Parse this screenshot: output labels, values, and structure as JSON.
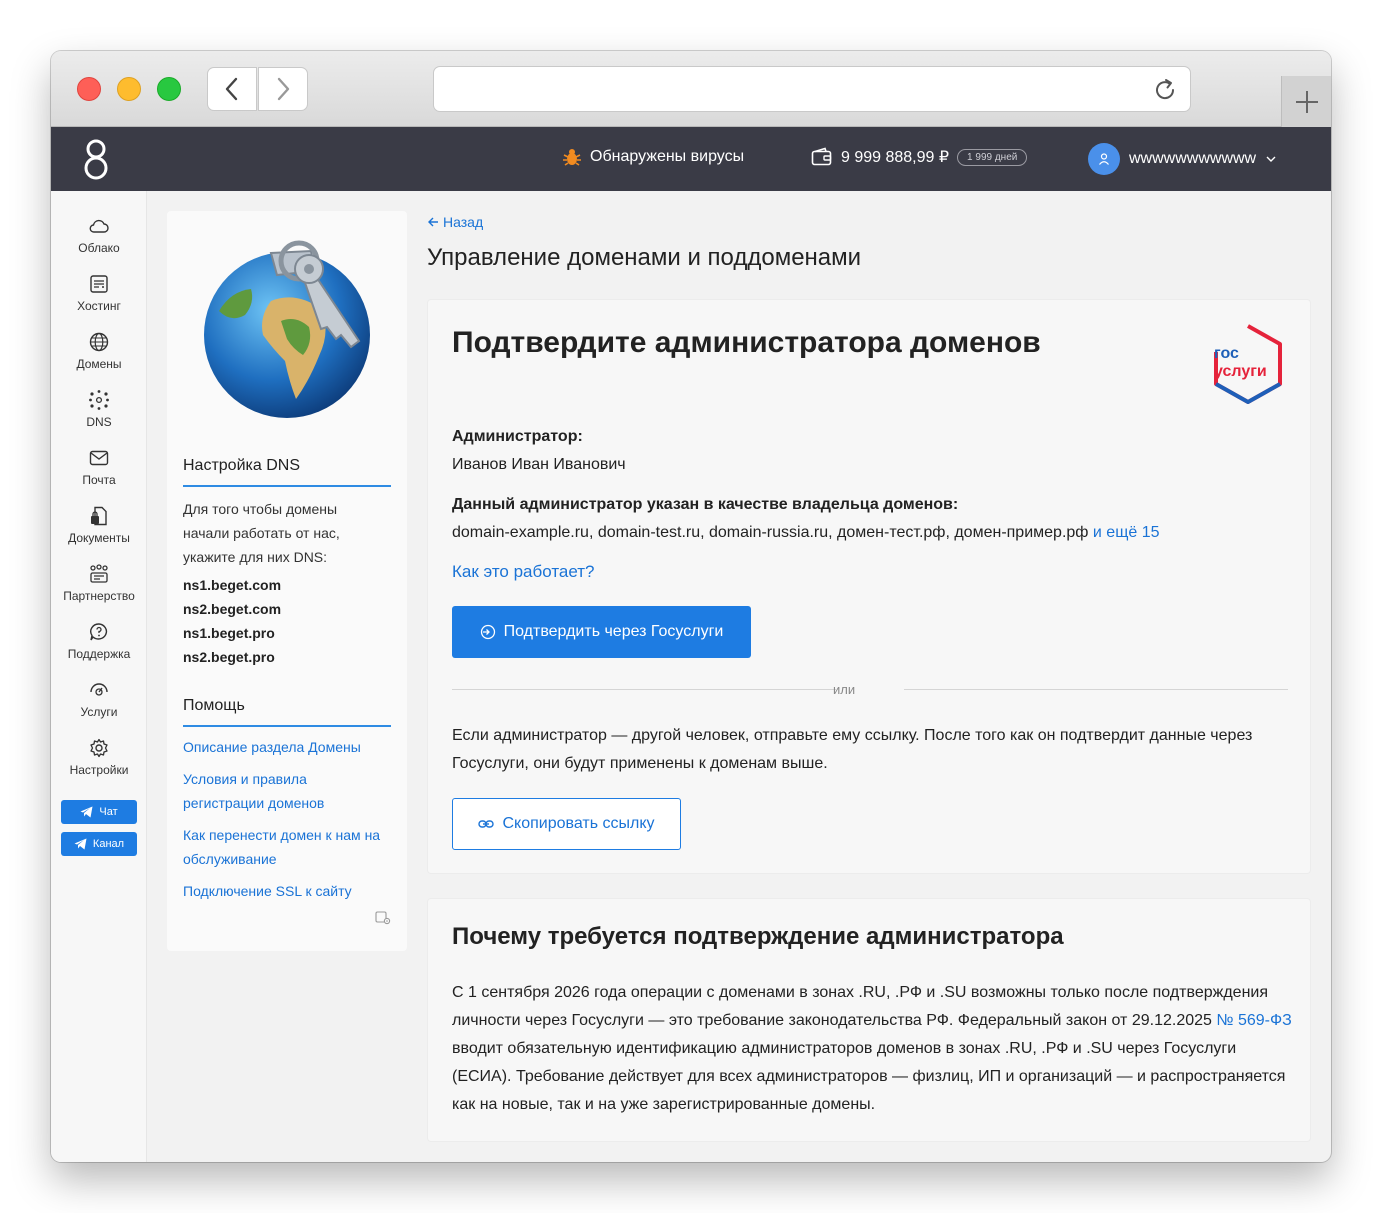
{
  "topbar": {
    "virus_text": "Обнаружены вирусы",
    "balance": "9 999 888,99 ₽",
    "days": "1 999 дней",
    "username": "wwwwwwwwwww"
  },
  "sidebar": {
    "items": [
      {
        "label": "Облако",
        "icon": "cloud-icon"
      },
      {
        "label": "Хостинг",
        "icon": "server-icon"
      },
      {
        "label": "Домены",
        "icon": "globe-icon"
      },
      {
        "label": "DNS",
        "icon": "dns-icon"
      },
      {
        "label": "Почта",
        "icon": "mail-icon"
      },
      {
        "label": "Документы",
        "icon": "document-lock-icon"
      },
      {
        "label": "Партнерство",
        "icon": "partners-icon"
      },
      {
        "label": "Поддержка",
        "icon": "support-icon"
      },
      {
        "label": "Услуги",
        "icon": "services-icon"
      },
      {
        "label": "Настройки",
        "icon": "gear-icon"
      }
    ],
    "chat_label": "Чат",
    "channel_label": "Канал"
  },
  "info": {
    "dns_title": "Настройка DNS",
    "dns_text": "Для того чтобы домены начали работать от нас, укажите для них DNS:",
    "ns": [
      "ns1.beget.com",
      "ns2.beget.com",
      "ns1.beget.pro",
      "ns2.beget.pro"
    ],
    "help_title": "Помощь",
    "help_links": [
      "Описание раздела Домены",
      "Условия и правила регистрации доменов",
      "Как перенести домен к нам на обслуживание",
      "Подключение SSL к сайту"
    ]
  },
  "main": {
    "back": "Назад",
    "title": "Управление доменами и поддоменами",
    "confirm": {
      "title": "Подтвердите администратора доменов",
      "admin_label": "Администратор:",
      "admin_name": "Иванов Иван Иванович",
      "owner_label": "Данный администратор указан в качестве владельца доменов:",
      "domains": "domain-example.ru, domain-test.ru, domain-russia.ru, домен-тест.рф, домен-пример.рф",
      "more": "и ещё 15",
      "how_link": "Как это работает?",
      "gosuslugi_button": "Подтвердить через Госуслуги",
      "or": "или",
      "other_text": "Если администратор — другой человек, отправьте ему ссылку. После того как он подтвердит данные через Госуслуги, они будут применены к доменам выше.",
      "copy_button": "Скопировать ссылку",
      "gos_logo_top": "гос",
      "gos_logo_bottom": "услуги"
    },
    "why": {
      "title": "Почему требуется подтверждение администратора",
      "text_before": "С 1 сентября 2026 года операции с доменами в зонах .RU, .РФ и .SU возможны только после подтверждения личности через Госуслуги — это требование законодательства РФ. Федеральный закон от 29.12.2025",
      "law_link": "№ 569-ФЗ",
      "text_after": "вводит обязательную идентификацию администраторов доменов в зонах .RU, .РФ и .SU через Госуслуги (ЕСИА). Требование действует для всех администраторов — физлиц, ИП и организаций — и распространяется как на новые, так и на уже зарегистрированные домены."
    }
  },
  "colors": {
    "accent": "#1e7ce2",
    "topbar": "#3a3b46",
    "link": "#1a73d6"
  }
}
